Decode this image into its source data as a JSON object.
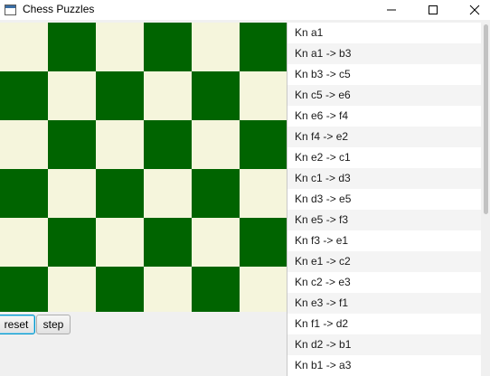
{
  "window": {
    "title": "Chess Puzzles"
  },
  "icons": {
    "app": "window-app-icon",
    "minimize": "minimize-icon",
    "maximize": "maximize-icon",
    "close": "close-icon"
  },
  "board": {
    "light_color": "#f5f5dc",
    "dark_color": "#006400",
    "columns": 6,
    "rows": 6,
    "top_left_is_light": true
  },
  "controls": {
    "reset_label": "reset",
    "step_label": "step"
  },
  "moves": [
    "Kn a1",
    "Kn a1 -> b3",
    "Kn b3 -> c5",
    "Kn c5 -> e6",
    "Kn e6 -> f4",
    "Kn f4 -> e2",
    "Kn e2 -> c1",
    "Kn c1 -> d3",
    "Kn d3 -> e5",
    "Kn e5 -> f3",
    "Kn f3 -> e1",
    "Kn e1 -> c2",
    "Kn c2 -> e3",
    "Kn e3 -> f1",
    "Kn f1 -> d2",
    "Kn d2 -> b1",
    "Kn b1 -> a3"
  ]
}
